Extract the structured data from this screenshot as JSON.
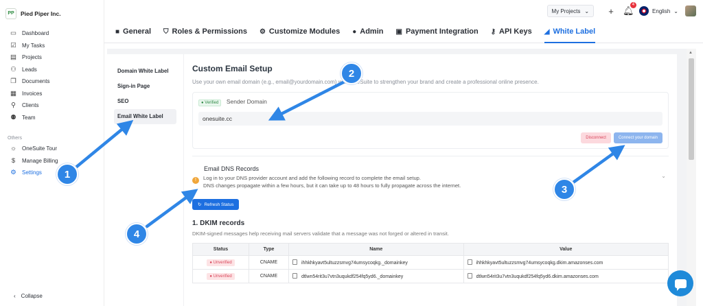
{
  "brand": {
    "name": "Pied Piper Inc.",
    "logo_text": "PP"
  },
  "sidebar": {
    "items": [
      {
        "label": "Dashboard",
        "icon": "dashboard-icon"
      },
      {
        "label": "My Tasks",
        "icon": "tasks-icon"
      },
      {
        "label": "Projects",
        "icon": "projects-icon"
      },
      {
        "label": "Leads",
        "icon": "leads-icon"
      },
      {
        "label": "Documents",
        "icon": "documents-icon"
      },
      {
        "label": "Invoices",
        "icon": "invoices-icon"
      },
      {
        "label": "Clients",
        "icon": "clients-icon"
      },
      {
        "label": "Team",
        "icon": "team-icon"
      }
    ],
    "section_label": "Others",
    "others": [
      {
        "label": "OneSuite Tour",
        "icon": "sun-icon"
      },
      {
        "label": "Manage Billing",
        "icon": "dollar-icon"
      },
      {
        "label": "Settings",
        "icon": "gear-icon"
      }
    ],
    "collapse_label": "Collapse"
  },
  "topbar": {
    "project_select": "My Projects",
    "notification_count": "4",
    "language": "English"
  },
  "tabs": [
    {
      "label": "General"
    },
    {
      "label": "Roles & Permissions"
    },
    {
      "label": "Customize Modules"
    },
    {
      "label": "Admin"
    },
    {
      "label": "Payment Integration"
    },
    {
      "label": "API Keys"
    },
    {
      "label": "White Label"
    }
  ],
  "subnav": [
    "Domain White Label",
    "Sign-in Page",
    "SEO",
    "Email White Label"
  ],
  "email_setup": {
    "title": "Custom Email Setup",
    "description": "Use your own email domain (e.g., email@yourdomain.com) with OneSuite to strengthen your brand and create a professional online presence.",
    "verified_badge": "Verified",
    "sender_label": "Sender Domain",
    "domain_value": "onesuite.cc",
    "disconnect_label": "Disconnect",
    "connect_label": "Connect your domain"
  },
  "dns": {
    "title": "Email DNS Records",
    "line1": "Log in to your DNS provider account and add the following record to complete the email setup.",
    "line2": "DNS changes propagate within a few hours, but it can take up to 48 hours to fully propagate across the internet.",
    "refresh_label": "Refresh Status",
    "dkim_title": "1. DKIM records",
    "dkim_desc": "DKIM-signed messages help receiving mail servers validate that a message was not forged or altered in transit.",
    "columns": [
      "Status",
      "Type",
      "Name",
      "Value"
    ],
    "rows": [
      {
        "status": "Unverified",
        "type": "CNAME",
        "name": "ihhkhkyavt5ultuzzsmvg74umsycoqkg._domainkey",
        "value": "ihhkhkyavt5ultuzzsmvg74umsycoqkg.dkim.amazonses.com"
      },
      {
        "status": "Unverified",
        "type": "CNAME",
        "name": "dtlwn54rit3u7vtn3uqukdf254fq5yd6._domainkey",
        "value": "dtlwn54rit3u7vtn3uqukdf254fq5yd6.dkim.amazonses.com"
      }
    ]
  },
  "markers": [
    "1",
    "2",
    "3",
    "4"
  ],
  "colors": {
    "accent": "#1d6fe0",
    "marker": "#2f86e6",
    "chat": "#1f8ad9"
  }
}
